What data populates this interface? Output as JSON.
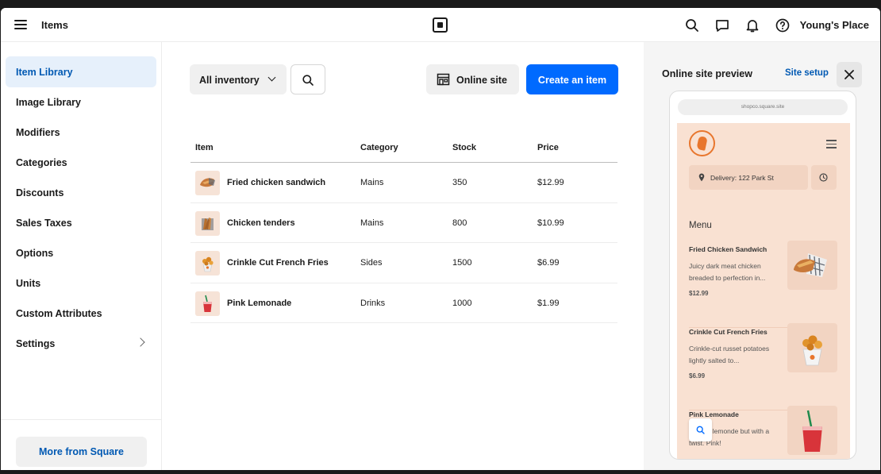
{
  "topbar": {
    "title": "Items",
    "account": "Young's Place",
    "icons": [
      "menu-icon",
      "search-icon",
      "chat-icon",
      "bell-icon",
      "help-icon"
    ]
  },
  "sidebar": {
    "items": [
      {
        "label": "Item Library",
        "active": true
      },
      {
        "label": "Image Library"
      },
      {
        "label": "Modifiers"
      },
      {
        "label": "Categories"
      },
      {
        "label": "Discounts"
      },
      {
        "label": "Sales Taxes"
      },
      {
        "label": "Options"
      },
      {
        "label": "Units"
      },
      {
        "label": "Custom Attributes"
      },
      {
        "label": "Settings"
      }
    ],
    "more_label": "More from Square"
  },
  "toolbar": {
    "filter_label": "All inventory",
    "online_label": "Online site",
    "create_label": "Create an item"
  },
  "table": {
    "columns": [
      "Item",
      "Category",
      "Stock",
      "Price"
    ],
    "rows": [
      {
        "name": "Fried chicken sandwich",
        "category": "Mains",
        "stock": "350",
        "price": "$12.99"
      },
      {
        "name": "Chicken tenders",
        "category": "Mains",
        "stock": "800",
        "price": "$10.99"
      },
      {
        "name": "Crinkle Cut French Fries",
        "category": "Sides",
        "stock": "1500",
        "price": "$6.99"
      },
      {
        "name": "Pink Lemonade",
        "category": "Drinks",
        "stock": "1000",
        "price": "$1.99"
      }
    ]
  },
  "preview": {
    "title": "Online site preview",
    "setup_label": "Site setup",
    "url": "shopco.square.site",
    "delivery": "Delivery: 122 Park St",
    "menu_heading": "Menu",
    "cards": [
      {
        "name": "Fried Chicken Sandwich",
        "desc": "Juicy dark meat chicken breaded to perfection in...",
        "price": "$12.99"
      },
      {
        "name": "Crinkle Cut French Fries",
        "desc": "Crinkle-cut russet potatoes lightly salted to...",
        "price": "$6.99"
      },
      {
        "name": "Pink Lemonade",
        "desc": "Classic lemonde but with a twist. Pink!",
        "price": ""
      }
    ]
  },
  "colors": {
    "accent": "#006aff",
    "link": "#0059b3",
    "active_bg": "#e6f0fb",
    "store_bg": "#f9e1d2",
    "brand": "#e8762d"
  }
}
